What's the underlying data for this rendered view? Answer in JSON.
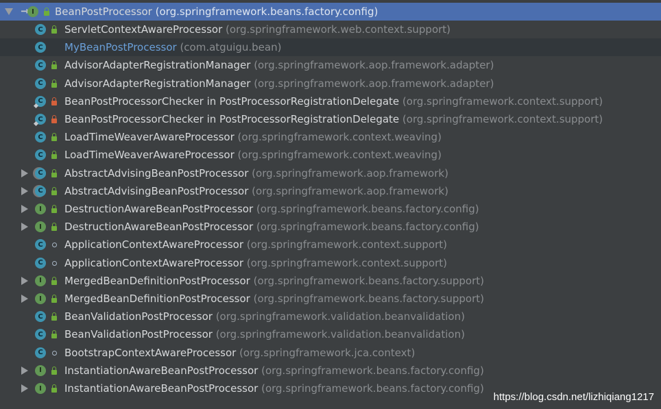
{
  "root": {
    "name": "BeanPostProcessor",
    "package": "(org.springframework.beans.factory.config)",
    "icon": "interface-icon",
    "expanded": true
  },
  "items": [
    {
      "name": "ServletContextAwareProcessor",
      "package": "(org.springframework.web.context.support)",
      "kind": "class",
      "lock": "green",
      "expandable": false
    },
    {
      "name": "MyBeanPostProcessor",
      "package": "(com.atguigu.bean)",
      "kind": "class",
      "lock": "none",
      "expandable": false,
      "highlight": true
    },
    {
      "name": "AdvisorAdapterRegistrationManager",
      "package": "(org.springframework.aop.framework.adapter)",
      "kind": "class",
      "lock": "green",
      "expandable": false
    },
    {
      "name": "AdvisorAdapterRegistrationManager",
      "package": "(org.springframework.aop.framework.adapter)",
      "kind": "class",
      "lock": "green",
      "expandable": false
    },
    {
      "name": "BeanPostProcessorChecker in PostProcessorRegistrationDelegate",
      "package": "(org.springframework.context.support)",
      "kind": "class",
      "lock": "red",
      "expandable": false
    },
    {
      "name": "BeanPostProcessorChecker in PostProcessorRegistrationDelegate",
      "package": "(org.springframework.context.support)",
      "kind": "class",
      "lock": "red",
      "expandable": false
    },
    {
      "name": "LoadTimeWeaverAwareProcessor",
      "package": "(org.springframework.context.weaving)",
      "kind": "class",
      "lock": "green",
      "expandable": false
    },
    {
      "name": "LoadTimeWeaverAwareProcessor",
      "package": "(org.springframework.context.weaving)",
      "kind": "class",
      "lock": "green",
      "expandable": false
    },
    {
      "name": "AbstractAdvisingBeanPostProcessor",
      "package": "(org.springframework.aop.framework)",
      "kind": "abstract",
      "lock": "green",
      "expandable": true
    },
    {
      "name": "AbstractAdvisingBeanPostProcessor",
      "package": "(org.springframework.aop.framework)",
      "kind": "abstract",
      "lock": "green",
      "expandable": true
    },
    {
      "name": "DestructionAwareBeanPostProcessor",
      "package": "(org.springframework.beans.factory.config)",
      "kind": "interface",
      "lock": "green",
      "expandable": true
    },
    {
      "name": "DestructionAwareBeanPostProcessor",
      "package": "(org.springframework.beans.factory.config)",
      "kind": "interface",
      "lock": "green",
      "expandable": true
    },
    {
      "name": "ApplicationContextAwareProcessor",
      "package": "(org.springframework.context.support)",
      "kind": "class",
      "lock": "dot",
      "expandable": false
    },
    {
      "name": "ApplicationContextAwareProcessor",
      "package": "(org.springframework.context.support)",
      "kind": "class",
      "lock": "dot",
      "expandable": false
    },
    {
      "name": "MergedBeanDefinitionPostProcessor",
      "package": "(org.springframework.beans.factory.support)",
      "kind": "interface",
      "lock": "green",
      "expandable": true
    },
    {
      "name": "MergedBeanDefinitionPostProcessor",
      "package": "(org.springframework.beans.factory.support)",
      "kind": "interface",
      "lock": "green",
      "expandable": true
    },
    {
      "name": "BeanValidationPostProcessor",
      "package": "(org.springframework.validation.beanvalidation)",
      "kind": "class",
      "lock": "green",
      "expandable": false
    },
    {
      "name": "BeanValidationPostProcessor",
      "package": "(org.springframework.validation.beanvalidation)",
      "kind": "class",
      "lock": "green",
      "expandable": false
    },
    {
      "name": "BootstrapContextAwareProcessor",
      "package": "(org.springframework.jca.context)",
      "kind": "class",
      "lock": "dot",
      "expandable": false
    },
    {
      "name": "InstantiationAwareBeanPostProcessor",
      "package": "(org.springframework.beans.factory.config)",
      "kind": "interface",
      "lock": "green",
      "expandable": true
    },
    {
      "name": "InstantiationAwareBeanPostProcessor",
      "package": "(org.springframework.beans.factory.config)",
      "kind": "interface",
      "lock": "green",
      "expandable": true
    }
  ],
  "watermark": "https://blog.csdn.net/lizhiqiang1217",
  "colors": {
    "background": "#3c3f41",
    "selection": "#4b6eaf",
    "hover": "#32373b",
    "class_icon": "#3e94b0",
    "interface_icon": "#629755",
    "text": "#d6d8da",
    "package_text": "#8a8d90",
    "link_text": "#6a9fd8"
  }
}
